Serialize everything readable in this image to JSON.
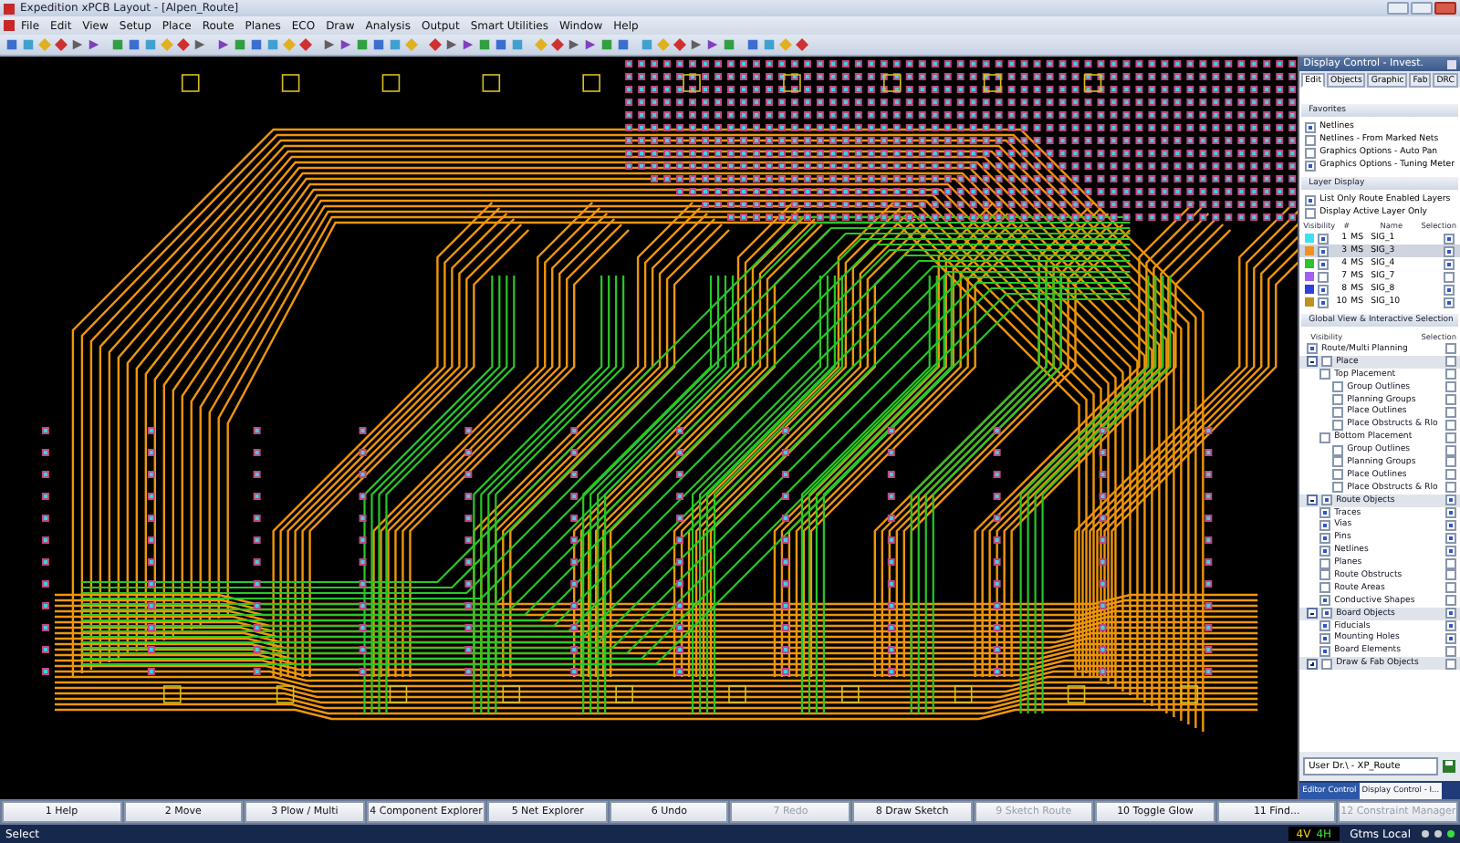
{
  "window": {
    "title": "Expedition xPCB Layout - [Alpen_Route]"
  },
  "menu": [
    "File",
    "Edit",
    "View",
    "Setup",
    "Place",
    "Route",
    "Planes",
    "ECO",
    "Draw",
    "Analysis",
    "Output",
    "Smart Utilities",
    "Window",
    "Help"
  ],
  "panel": {
    "title": "Display Control - Invest.",
    "tabs": [
      {
        "label": "Edit",
        "selected": true
      },
      {
        "label": "Objects",
        "selected": false
      },
      {
        "label": "Graphic",
        "selected": false
      },
      {
        "label": "Fab",
        "selected": false
      },
      {
        "label": "DRC",
        "selected": false
      }
    ],
    "favorites": {
      "title": "Favorites",
      "items": [
        {
          "label": "Netlines",
          "checked": true
        },
        {
          "label": "Netlines - From Marked Nets",
          "checked": false
        },
        {
          "label": "Graphics Options - Auto Pan",
          "checked": false
        },
        {
          "label": "Graphics Options - Tuning Meter",
          "checked": true
        }
      ]
    },
    "layer_display": {
      "title": "Layer Display",
      "options": [
        {
          "label": "List Only Route Enabled Layers",
          "checked": true
        },
        {
          "label": "Display Active Layer Only",
          "checked": false
        }
      ],
      "columns": [
        "Visibility",
        "#",
        "Name",
        "Selection"
      ],
      "layers": [
        {
          "number": "1",
          "type": "MS",
          "name": "SIG_1",
          "color": "#40e0f0",
          "visible": true,
          "selectable": true,
          "selected": false
        },
        {
          "number": "3",
          "type": "MS",
          "name": "SIG_3",
          "color": "#f09020",
          "visible": true,
          "selectable": true,
          "selected": true
        },
        {
          "number": "4",
          "type": "MS",
          "name": "SIG_4",
          "color": "#30c030",
          "visible": true,
          "selectable": true,
          "selected": false
        },
        {
          "number": "7",
          "type": "MS",
          "name": "SIG_7",
          "color": "#a060f0",
          "visible": false,
          "selectable": false,
          "selected": false
        },
        {
          "number": "8",
          "type": "MS",
          "name": "SIG_8",
          "color": "#3040e0",
          "visible": true,
          "selectable": true,
          "selected": false
        },
        {
          "number": "10",
          "type": "MS",
          "name": "SIG_10",
          "color": "#c09020",
          "visible": true,
          "selectable": true,
          "selected": false
        }
      ]
    },
    "global_view": {
      "title": "Global View & Interactive Selection",
      "columns": [
        "Visibility",
        "Selection"
      ],
      "items": [
        {
          "label": "Route/Multi Planning",
          "visible": true,
          "selectable": false
        },
        {
          "label": "Place",
          "visible": false,
          "selectable": false,
          "expanded": true,
          "children": [
            {
              "label": "Top Placement",
              "visible": false,
              "selectable": false,
              "children": [
                {
                  "label": "Group Outlines",
                  "visible": false,
                  "selectable": false
                },
                {
                  "label": "Planning Groups",
                  "visible": false,
                  "selectable": false
                },
                {
                  "label": "Place Outlines",
                  "visible": false,
                  "selectable": false
                },
                {
                  "label": "Place Obstructs & Rlo",
                  "visible": false,
                  "selectable": false
                }
              ]
            },
            {
              "label": "Bottom Placement",
              "visible": false,
              "selectable": false,
              "children": [
                {
                  "label": "Group Outlines",
                  "visible": false,
                  "selectable": false
                },
                {
                  "label": "Planning Groups",
                  "visible": false,
                  "selectable": false
                },
                {
                  "label": "Place Outlines",
                  "visible": false,
                  "selectable": false
                },
                {
                  "label": "Place Obstructs & Rlo",
                  "visible": false,
                  "selectable": false
                }
              ]
            }
          ]
        },
        {
          "label": "Route Objects",
          "visible": true,
          "selectable": true,
          "expanded": true,
          "children": [
            {
              "label": "Traces",
              "visible": true,
              "selectable": true
            },
            {
              "label": "Vias",
              "visible": true,
              "selectable": true
            },
            {
              "label": "Pins",
              "visible": true,
              "selectable": true
            },
            {
              "label": "Netlines",
              "visible": true,
              "selectable": true
            },
            {
              "label": "Planes",
              "visible": false,
              "selectable": false
            },
            {
              "label": "Route Obstructs",
              "visible": false,
              "selectable": false
            },
            {
              "label": "Route Areas",
              "visible": false,
              "selectable": false
            },
            {
              "label": "Conductive Shapes",
              "visible": true,
              "selectable": false
            }
          ]
        },
        {
          "label": "Board Objects",
          "visible": true,
          "selectable": true,
          "expanded": true,
          "children": [
            {
              "label": "Fiducials",
              "visible": true,
              "selectable": true
            },
            {
              "label": "Mounting Holes",
              "visible": true,
              "selectable": true
            },
            {
              "label": "Board Elements",
              "visible": true,
              "selectable": false
            }
          ]
        },
        {
          "label": "Draw & Fab Objects",
          "visible": false,
          "selectable": false,
          "expanded": false
        }
      ]
    },
    "scheme": "User Dr.\\ - XP_Route",
    "bottom_tabs": [
      {
        "label": "Editor Control",
        "selected": false
      },
      {
        "label": "Display Control - I...",
        "selected": true
      }
    ]
  },
  "function_keys": [
    {
      "label": "1 Help",
      "disabled": false
    },
    {
      "label": "2 Move",
      "disabled": false
    },
    {
      "label": "3 Plow / Multi",
      "disabled": false
    },
    {
      "label": "4 Component Explorer",
      "disabled": false
    },
    {
      "label": "5 Net Explorer",
      "disabled": false
    },
    {
      "label": "6 Undo",
      "disabled": false
    },
    {
      "label": "7 Redo",
      "disabled": true
    },
    {
      "label": "8 Draw Sketch",
      "disabled": false
    },
    {
      "label": "9 Sketch Route",
      "disabled": true
    },
    {
      "label": "10 Toggle Glow",
      "disabled": false
    },
    {
      "label": "11 Find...",
      "disabled": false
    },
    {
      "label": "12 Constraint Manager",
      "disabled": true
    }
  ],
  "status_bar": {
    "mode": "Select",
    "layer_vertical": "4V",
    "layer_horizontal": "4H",
    "units": "Gtms Local"
  }
}
